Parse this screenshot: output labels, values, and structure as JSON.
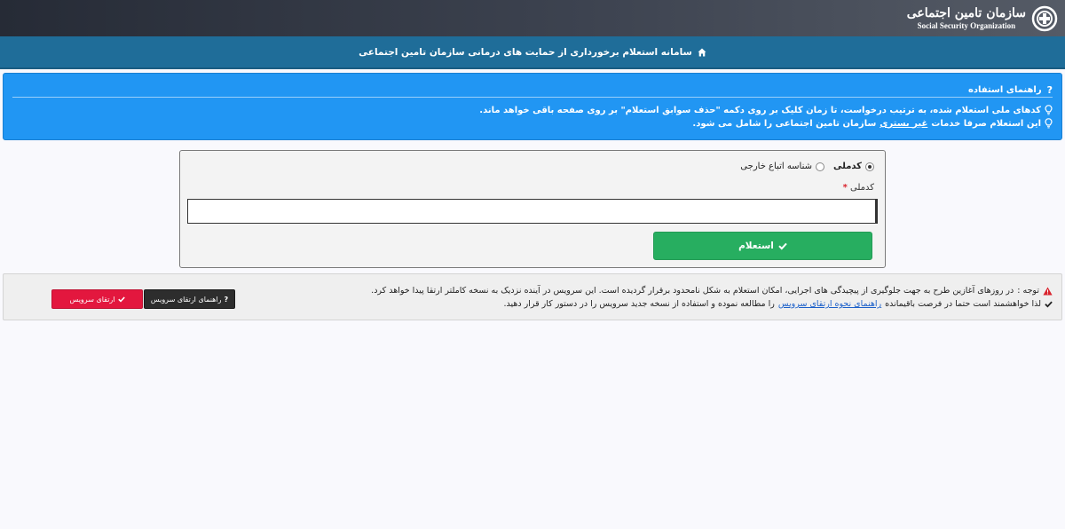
{
  "header": {
    "brand_fa": "سازمان تامین اجتماعی",
    "brand_en": "Social Security Organization"
  },
  "titlebar": {
    "icon": "home-icon",
    "title": "سامانه استعلام برخورداری از حمایت های درمانی سازمان تامین اجتماعی"
  },
  "guide": {
    "icon": "question-icon",
    "title": "راهنمای استفاده",
    "line1": "کدهای ملی استعلام شده، به ترتیب درخواست، تا زمان کلیک بر روی دکمه \"حذف سوابق استعلام\" بر روی صفحه باقی خواهد ماند.",
    "line2_before": "این استعلام صرفا خدمات",
    "line2_underlined": "غیر بستری",
    "line2_after": "سازمان تامین اجتماعی را شامل می شود.",
    "color": "#2196f3"
  },
  "form": {
    "radio_national": "کدملی",
    "radio_foreign": "شناسه اتباع خارجی",
    "selected": "کدملی",
    "field_label": "کدملی",
    "required_mark": "*",
    "input_value": "",
    "submit_label": "استعلام",
    "submit_color": "#27ae60"
  },
  "notice": {
    "line1_prefix": "توجه :",
    "line1": "در روزهای آغازین طرح به جهت جلوگیری از پیچیدگی های اجرایی، امکان استعلام به شکل نامحدود برقرار گردیده است. این سرویس در آینده نزدیک به نسخه کاملتر ارتقا پیدا خواهد کرد.",
    "line2_before": "لذا خواهشمند است حتما در فرصت باقیمانده",
    "line2_link": "راهنمای نحوه ارتقای سرویس",
    "line2_after": "را مطالعه نموده و استفاده از نسخه جدید سرویس را در دستور کار قرار دهید.",
    "guide_button": "راهنمای ارتقای سرویس",
    "upgrade_button": "ارتقای سرویس",
    "warning_color": "#d9232d",
    "upgrade_color": "#e3173e"
  }
}
